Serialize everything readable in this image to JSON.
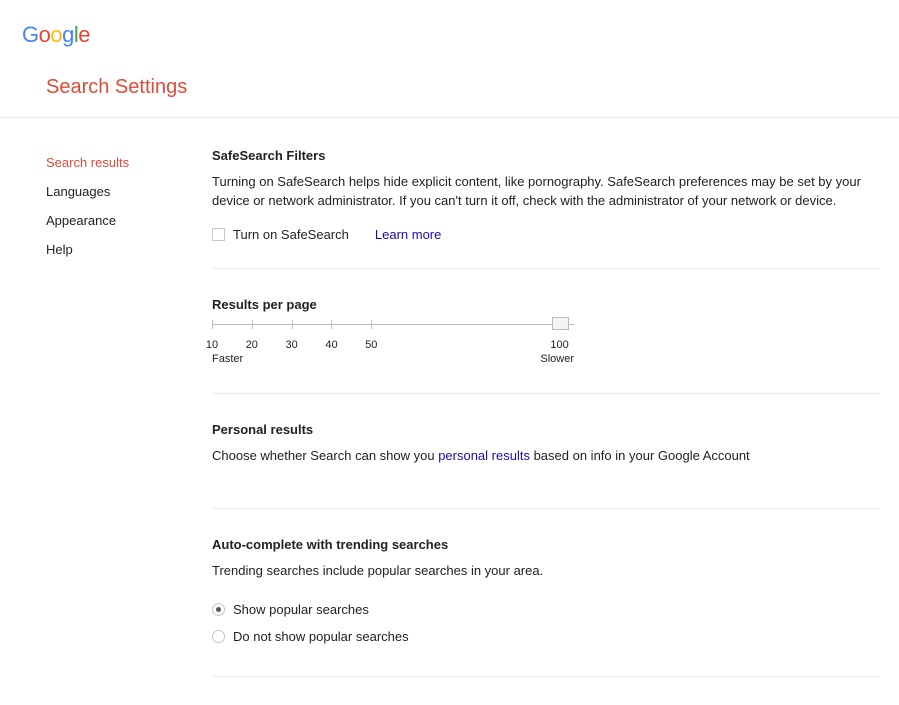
{
  "header": {
    "logo": "Google",
    "page_title": "Search Settings"
  },
  "sidebar": {
    "items": [
      {
        "label": "Search results",
        "active": true
      },
      {
        "label": "Languages",
        "active": false
      },
      {
        "label": "Appearance",
        "active": false
      },
      {
        "label": "Help",
        "active": false
      }
    ]
  },
  "safesearch": {
    "title": "SafeSearch Filters",
    "desc": "Turning on SafeSearch helps hide explicit content, like pornography. SafeSearch preferences may be set by your device or network administrator. If you can't turn it off, check with the administrator of your network or device.",
    "checkbox_label": "Turn on SafeSearch",
    "learn_more": "Learn more"
  },
  "results_per_page": {
    "title": "Results per page",
    "options": [
      "10",
      "20",
      "30",
      "40",
      "50",
      "100"
    ],
    "selected": "100",
    "faster_hint": "Faster",
    "slower_hint": "Slower"
  },
  "personal": {
    "title": "Personal results",
    "desc_pre": "Choose whether Search can show you ",
    "link": "personal results",
    "desc_post": " based on info in your Google Account"
  },
  "autocomplete": {
    "title": "Auto-complete with trending searches",
    "desc": "Trending searches include popular searches in your area.",
    "options": [
      {
        "label": "Show popular searches",
        "checked": true
      },
      {
        "label": "Do not show popular searches",
        "checked": false
      }
    ]
  }
}
